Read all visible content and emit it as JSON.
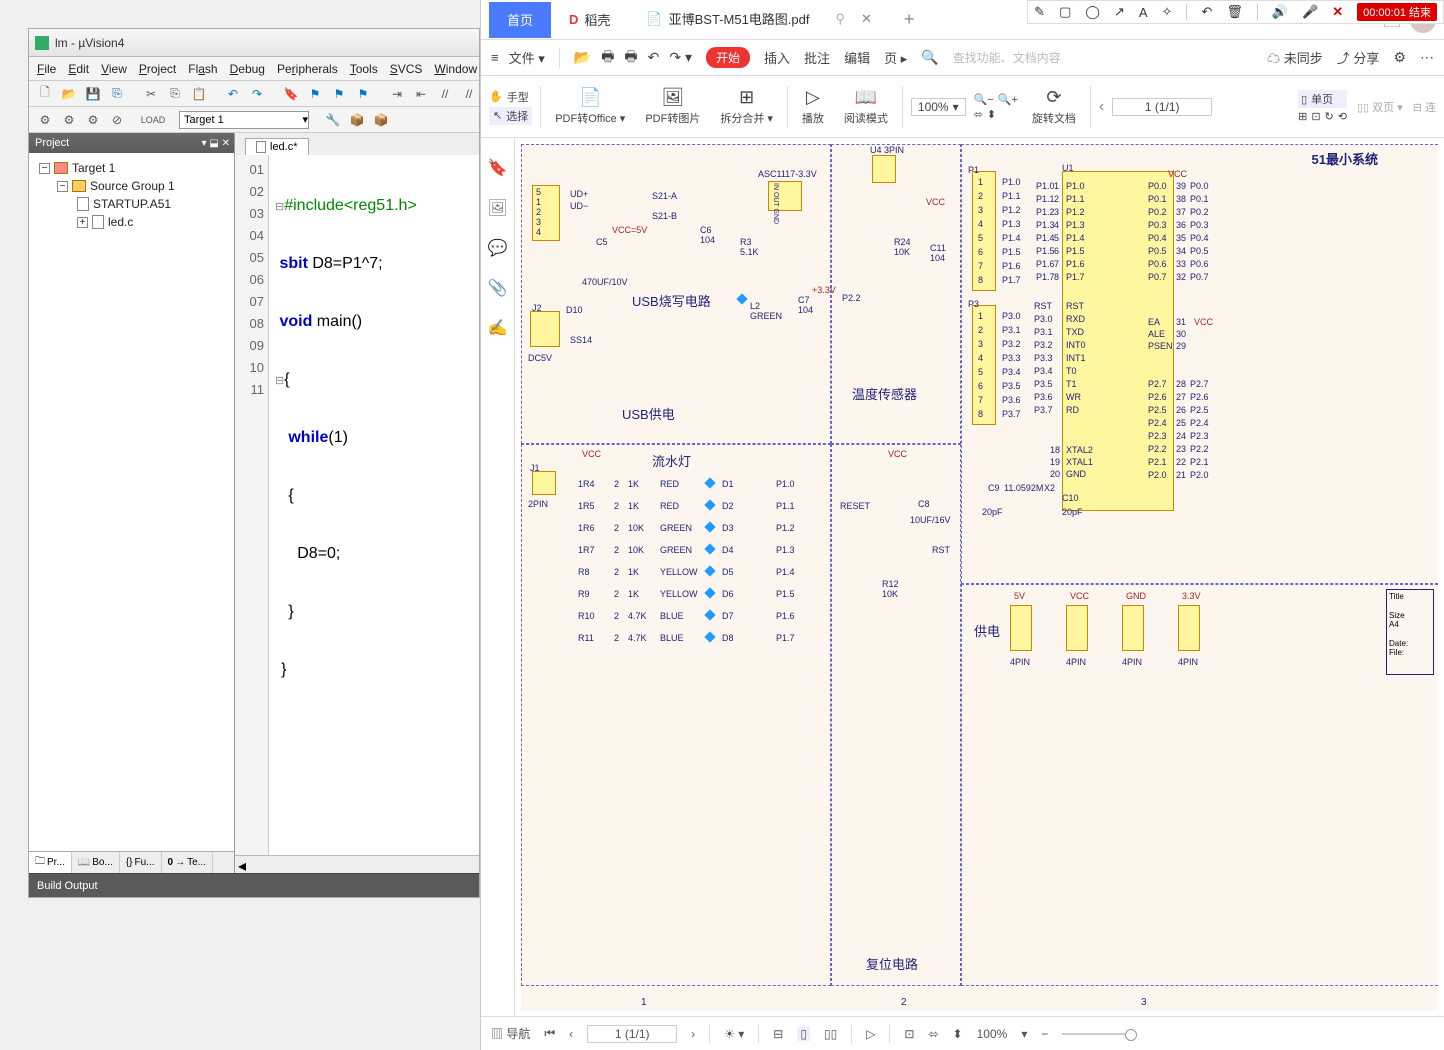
{
  "anno": {
    "close": "✕",
    "timer": "00:00:01 结束"
  },
  "uvision": {
    "title": "lm - µVision4",
    "menu": [
      "File",
      "Edit",
      "View",
      "Project",
      "Flash",
      "Debug",
      "Peripherals",
      "Tools",
      "SVCS",
      "Window"
    ],
    "target_combo": "Target 1",
    "project_panel_title": "Project",
    "tree": {
      "target": "Target 1",
      "group": "Source Group 1",
      "files": [
        "STARTUP.A51",
        "led.c"
      ]
    },
    "proj_tabs": [
      "Pr...",
      "Bo...",
      "Fu...",
      "Te..."
    ],
    "code_tab": "led.c*",
    "gutter": [
      "01",
      "02",
      "03",
      "04",
      "05",
      "06",
      "07",
      "08",
      "09",
      "10",
      "11"
    ],
    "code": {
      "l1_include": "#include",
      "l1_hdr": "<reg51.h>",
      "l2_sbit": "sbit",
      "l2_rest": " D8=P1^7;",
      "l3_void": "void",
      "l3_main": " main()",
      "l4": "{",
      "l5_while": "while",
      "l5_arg": "(1)",
      "l6": "{",
      "l7": "D8=0;",
      "l8": "}",
      "l9": "}"
    },
    "build_title": "Build Output"
  },
  "pdf": {
    "tab_home": "首页",
    "tab_doc": "稻壳",
    "tab_file": "亚博BST-M51电路图.pdf",
    "menu": {
      "file": "文件",
      "start": "开始",
      "items": [
        "插入",
        "批注",
        "编辑",
        "页"
      ],
      "search_ph": "查找功能、文档内容",
      "nosync": "未同步",
      "share": "分享"
    },
    "ribbon": {
      "hand": "手型",
      "select": "选择",
      "pdf2office": "PDF转Office",
      "pdf2img": "PDF转图片",
      "split": "拆分合并",
      "play": "播放",
      "read": "阅读模式",
      "zoom_val": "100%",
      "rotate": "旋转文档",
      "single": "单页",
      "double": "双页",
      "page_display": "1 (1/1)"
    },
    "schematic": {
      "usb_title": "USB供电",
      "usb_write": "USB烧写电路",
      "vcc5v": "VCC=5V",
      "cap": "470UF/10V",
      "asc": "ASC1117-3.3V",
      "v33": "+3.3V",
      "green": "GREEN",
      "dc5v": "DC5V",
      "ss14": "SS14",
      "temp_title": "温度传感器",
      "reset_title": "复位电路",
      "reset": "RESET",
      "rst": "RST",
      "led_title": "流水灯",
      "led_rows": [
        {
          "r": "1R4",
          "v": "1K",
          "c": "RED",
          "d": "D1",
          "p": "P1.0"
        },
        {
          "r": "1R5",
          "v": "1K",
          "c": "RED",
          "d": "D2",
          "p": "P1.1"
        },
        {
          "r": "1R6",
          "v": "10K",
          "c": "GREEN",
          "d": "D3",
          "p": "P1.2"
        },
        {
          "r": "1R7",
          "v": "10K",
          "c": "GREEN",
          "d": "D4",
          "p": "P1.3"
        },
        {
          "r": "R8",
          "v": "1K",
          "c": "YELLOW",
          "d": "D5",
          "p": "P1.4"
        },
        {
          "r": "R9",
          "v": "1K",
          "c": "YELLOW",
          "d": "D6",
          "p": "P1.5"
        },
        {
          "r": "R10",
          "v": "4.7K",
          "c": "BLUE",
          "d": "D7",
          "p": "P1.6"
        },
        {
          "r": "R11",
          "v": "4.7K",
          "c": "BLUE",
          "d": "D8",
          "p": "P1.7"
        }
      ],
      "sys_title": "51最小系统",
      "power_title": "供电",
      "power_lbls": [
        "5V",
        "VCC",
        "GND",
        "3.3V"
      ],
      "power_pin": "4PIN",
      "xtal": "11.0592M",
      "cap20": "20pF",
      "c8": "10UF/16V",
      "pins_left": [
        "P1.0",
        "P1.1",
        "P1.2",
        "P1.3",
        "P1.4",
        "P1.5",
        "P1.6",
        "P1.7"
      ],
      "pins_left_num": [
        "1",
        "2",
        "3",
        "4",
        "5",
        "6",
        "7",
        "8"
      ],
      "pins_p3": [
        "P3.0",
        "P3.1",
        "P3.2",
        "P3.3",
        "P3.4",
        "P3.5",
        "P3.6",
        "P3.7"
      ],
      "sig": [
        "RST",
        "RXD",
        "TXD",
        "INT0",
        "INT1",
        "T0",
        "T1",
        "WR",
        "RD"
      ],
      "right_p0": [
        "P0.0",
        "P0.1",
        "P0.2",
        "P0.3",
        "P0.4",
        "P0.5",
        "P0.6",
        "P0.7"
      ],
      "right_p2": [
        "P2.7",
        "P2.6",
        "P2.5",
        "P2.4",
        "P2.3",
        "P2.2",
        "P2.1",
        "P2.0"
      ],
      "ealepsen": [
        "EA",
        "ALE",
        "PSEN"
      ],
      "xtal_lbl": [
        "XTAL2",
        "XTAL1",
        "GND"
      ]
    },
    "status": {
      "nav": "导航",
      "page": "1 (1/1)",
      "zoom": "100%"
    }
  }
}
